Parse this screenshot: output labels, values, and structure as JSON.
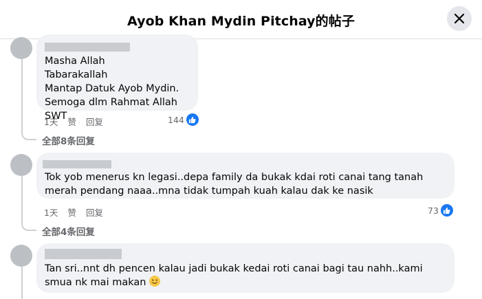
{
  "header": {
    "title": "Ayob Khan Mydin Pitchay的帖子"
  },
  "comments": [
    {
      "text": "Masha Allah\nTabarakallah\nMantap Datuk Ayob Mydin.\nSemoga dlm Rahmat Allah SWT",
      "time": "1天",
      "like_label": "赞",
      "reply_label": "回复",
      "like_count": "144",
      "view_replies": "全部8条回复"
    },
    {
      "text": "Tok yob menerus kn legasi..depa family da bukak kdai roti canai tang tanah merah pendang naaa..mna tidak tumpah kuah kalau dak ke nasik",
      "time": "1天",
      "like_label": "赞",
      "reply_label": "回复",
      "like_count": "73",
      "view_replies": "全部4条回复"
    },
    {
      "text": "Tan sri..nnt dh pencen kalau jadi bukak kedai roti canai bagi tau nahh..kami smua nk mai makan"
    }
  ],
  "icons": {
    "close": "close-icon",
    "like": "thumbs-up-icon",
    "emoji": "smiling-face-emoji"
  },
  "colors": {
    "accent": "#1877f2",
    "bubble": "#f0f2f5",
    "muted": "#65676b"
  }
}
